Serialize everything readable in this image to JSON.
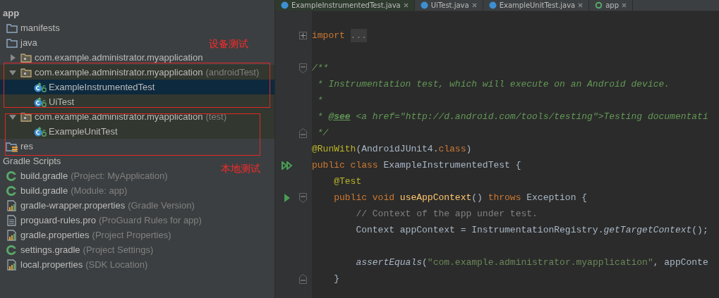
{
  "tabs": [
    {
      "label": "ExampleInstrumentedTest.java",
      "kind": "class",
      "selected": true
    },
    {
      "label": "UiTest.java",
      "kind": "class",
      "selected": false
    },
    {
      "label": "ExampleUnitTest.java",
      "kind": "class",
      "selected": false
    },
    {
      "label": "app",
      "kind": "gradle",
      "selected": false
    }
  ],
  "tree": [
    {
      "label": "app",
      "kind": "module",
      "children": [
        {
          "label": "manifests",
          "kind": "folder"
        },
        {
          "label": "java",
          "kind": "folder",
          "children": [
            {
              "label": "com.example.administrator.myapplication",
              "kind": "package",
              "expanded": false
            },
            {
              "label": "com.example.administrator.myapplication",
              "note": "(androidTest)",
              "kind": "package",
              "expanded": true,
              "highlighted": true,
              "children": [
                {
                  "label": "ExampleInstrumentedTest",
                  "kind": "test-class",
                  "selected": true,
                  "highlighted": true
                },
                {
                  "label": "UiTest",
                  "kind": "test-class",
                  "selected": false,
                  "highlighted": true
                }
              ]
            },
            {
              "label": "com.example.administrator.myapplication",
              "note": "(test)",
              "kind": "package",
              "expanded": true,
              "highlighted": true,
              "children": [
                {
                  "label": "ExampleUnitTest",
                  "kind": "test-class",
                  "selected": false,
                  "highlighted": true
                }
              ]
            }
          ]
        },
        {
          "label": "res",
          "kind": "res-folder"
        }
      ]
    },
    {
      "label": "Gradle Scripts",
      "kind": "group",
      "children": [
        {
          "label": "build.gradle",
          "note": "(Project: MyApplication)",
          "kind": "gradle"
        },
        {
          "label": "build.gradle",
          "note": "(Module: app)",
          "kind": "gradle"
        },
        {
          "label": "gradle-wrapper.properties",
          "note": "(Gradle Version)",
          "kind": "properties"
        },
        {
          "label": "proguard-rules.pro",
          "note": "(ProGuard Rules for app)",
          "kind": "text-file"
        },
        {
          "label": "gradle.properties",
          "note": "(Project Properties)",
          "kind": "properties"
        },
        {
          "label": "settings.gradle",
          "note": "(Project Settings)",
          "kind": "gradle"
        },
        {
          "label": "local.properties",
          "note": "(SDK Location)",
          "kind": "properties"
        }
      ]
    }
  ],
  "annotations": [
    {
      "label": "设备测试"
    },
    {
      "label": "本地测试"
    }
  ],
  "code": [
    {
      "kind": "blank"
    },
    {
      "kind": "code",
      "markers": [
        {
          "kind": "fold-expand"
        }
      ],
      "tokens": [
        {
          "kind": "kw",
          "text": "import "
        },
        {
          "kind": "folded",
          "text": "..."
        }
      ]
    },
    {
      "kind": "blank"
    },
    {
      "kind": "code",
      "markers": [
        {
          "kind": "fold-start"
        }
      ],
      "tokens": [
        {
          "kind": "doc",
          "text": "/**"
        }
      ]
    },
    {
      "kind": "code",
      "tokens": [
        {
          "kind": "doc",
          "text": " * Instrumentation test, which will execute on an Android device."
        }
      ]
    },
    {
      "kind": "code",
      "tokens": [
        {
          "kind": "doc",
          "text": " *"
        }
      ]
    },
    {
      "kind": "code",
      "tokens": [
        {
          "kind": "doc",
          "text": " * "
        },
        {
          "kind": "doctag",
          "text": "@see"
        },
        {
          "kind": "doc",
          "text": " <a href=\"http://d.android.com/tools/testing\">Testing documentati"
        }
      ]
    },
    {
      "kind": "code",
      "markers": [
        {
          "kind": "fold-end"
        }
      ],
      "tokens": [
        {
          "kind": "doc",
          "text": " */"
        }
      ]
    },
    {
      "kind": "code",
      "tokens": [
        {
          "kind": "ann",
          "text": "@RunWith"
        },
        {
          "kind": "plain",
          "text": "(AndroidJUnit4."
        },
        {
          "kind": "kw",
          "text": "class"
        },
        {
          "kind": "plain",
          "text": ")"
        }
      ]
    },
    {
      "kind": "code",
      "markers": [
        {
          "kind": "run-all"
        }
      ],
      "tokens": [
        {
          "kind": "kw",
          "text": "public class "
        },
        {
          "kind": "plain",
          "text": "ExampleInstrumentedTest {"
        }
      ]
    },
    {
      "kind": "code",
      "tokens": [
        {
          "kind": "ann",
          "text": "    @Test"
        }
      ]
    },
    {
      "kind": "code",
      "markers": [
        {
          "kind": "run"
        },
        {
          "kind": "fold-start"
        }
      ],
      "tokens": [
        {
          "kind": "kw",
          "text": "    public void "
        },
        {
          "kind": "method",
          "text": "useAppContext"
        },
        {
          "kind": "plain",
          "text": "() "
        },
        {
          "kind": "kw",
          "text": "throws "
        },
        {
          "kind": "plain",
          "text": "Exception {"
        }
      ]
    },
    {
      "kind": "code",
      "tokens": [
        {
          "kind": "comment",
          "text": "        // Context of the app under test."
        }
      ]
    },
    {
      "kind": "code",
      "tokens": [
        {
          "kind": "plain",
          "text": "        Context appContext = InstrumentationRegistry."
        },
        {
          "kind": "static",
          "text": "getTargetContext"
        },
        {
          "kind": "plain",
          "text": "();"
        }
      ]
    },
    {
      "kind": "blank"
    },
    {
      "kind": "code",
      "tokens": [
        {
          "kind": "static",
          "text": "        assertEquals"
        },
        {
          "kind": "plain",
          "text": "("
        },
        {
          "kind": "string",
          "text": "\"com.example.administrator.myapplication\""
        },
        {
          "kind": "plain",
          "text": ", appConte"
        }
      ]
    },
    {
      "kind": "code",
      "markers": [
        {
          "kind": "fold-end"
        }
      ],
      "tokens": [
        {
          "kind": "plain",
          "text": "    }"
        }
      ]
    }
  ]
}
